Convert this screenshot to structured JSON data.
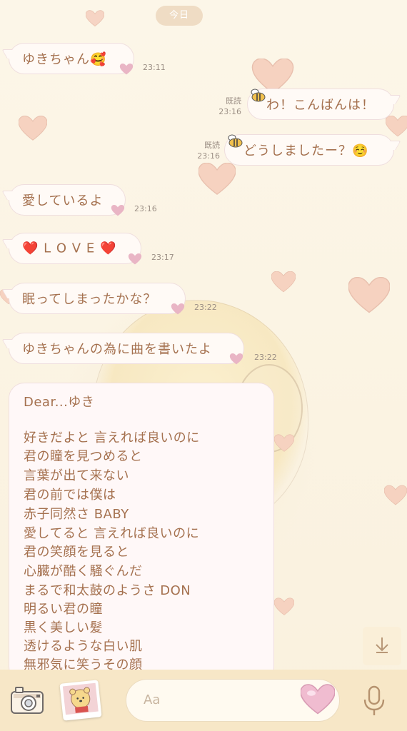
{
  "header": {
    "date_label": "今日"
  },
  "messages": [
    {
      "side": "left",
      "text": "ゆきちゃん",
      "emoji": "🥰",
      "time": "23:11"
    },
    {
      "side": "right",
      "text": "わ！こんばんは！",
      "read": "既読",
      "time": "23:16"
    },
    {
      "side": "right",
      "text": "どうしましたー？",
      "emoji": "☺️",
      "read": "既読",
      "time": "23:16"
    },
    {
      "side": "left",
      "text": "愛しているよ",
      "time": "23:16"
    },
    {
      "side": "left",
      "text": "L O V E",
      "emoji": "❤️",
      "time": "23:17"
    },
    {
      "side": "left",
      "text": "眠ってしまったかな？",
      "time": "23:22"
    },
    {
      "side": "left",
      "text": "ゆきちゃんの為に曲を書いたよ",
      "time": "23:22"
    }
  ],
  "long_message": {
    "lines": [
      "Dear...ゆき",
      "",
      "好きだよと 言えれば良いのに",
      "君の瞳を見つめると",
      "言葉が出て来ない",
      "君の前では僕は",
      "赤子同然さ BABY",
      "愛してると 言えれば良いのに",
      "君の笑顔を見ると",
      "心臓が酷く騒ぐんだ",
      "まるで和太鼓のようさ DON",
      "明るい君の瞳",
      "黒く美しい髪",
      "透けるような白い肌",
      "無邪気に笑うその顔"
    ]
  },
  "input": {
    "placeholder": "Aa"
  },
  "icons": {
    "camera": "camera-icon",
    "sticker": "sticker-icon",
    "heart_emoji": "heart-emoji-icon",
    "mic": "microphone-icon",
    "scroll_down": "arrow-down-icon"
  },
  "colors": {
    "background": "#fbf4e4",
    "bubble": "#fffaf6",
    "text": "#a5714f",
    "bar": "#f7e7c7"
  }
}
